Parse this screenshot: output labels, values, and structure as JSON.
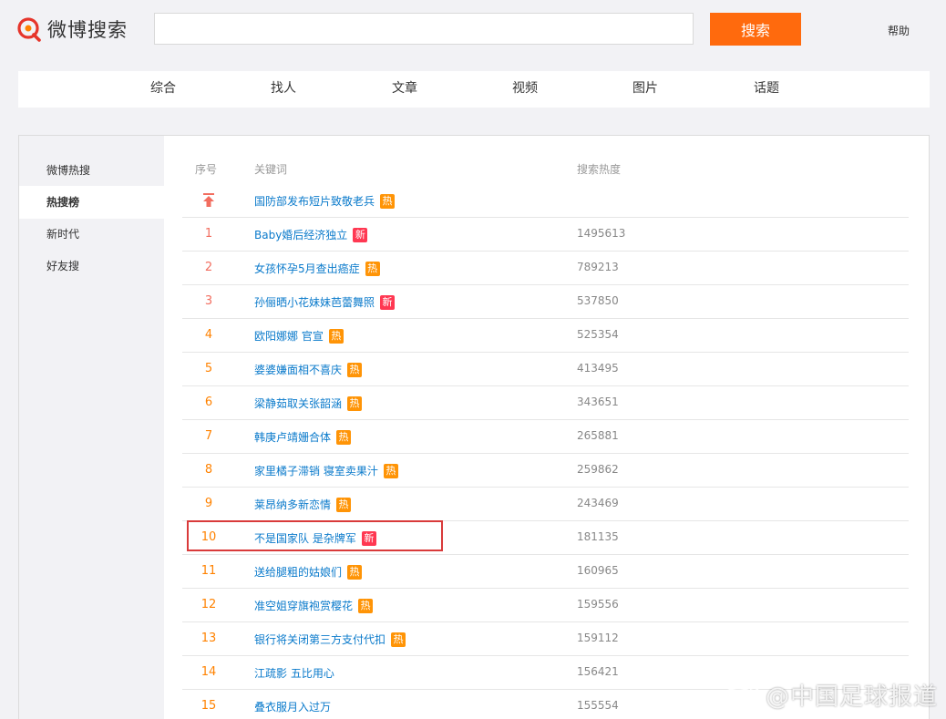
{
  "header": {
    "logo_text": "微博搜索",
    "search_placeholder": "",
    "search_button": "搜索",
    "help": "帮助"
  },
  "nav": [
    "综合",
    "找人",
    "文章",
    "视频",
    "图片",
    "话题"
  ],
  "sidebar": [
    "微博热搜",
    "热搜榜",
    "新时代",
    "好友搜"
  ],
  "table": {
    "headers": {
      "rank": "序号",
      "keyword": "关键词",
      "heat": "搜索热度"
    },
    "pinned": {
      "keyword": "国防部发布短片致敬老兵",
      "badge": "热"
    },
    "rows": [
      {
        "rank": "1",
        "keyword": "Baby婚后经济独立",
        "badge": "新",
        "heat": "1495613"
      },
      {
        "rank": "2",
        "keyword": "女孩怀孕5月查出癌症",
        "badge": "热",
        "heat": "789213"
      },
      {
        "rank": "3",
        "keyword": "孙俪晒小花妹妹芭蕾舞照",
        "badge": "新",
        "heat": "537850"
      },
      {
        "rank": "4",
        "keyword": "欧阳娜娜 官宣",
        "badge": "热",
        "heat": "525354"
      },
      {
        "rank": "5",
        "keyword": "婆婆嫌面相不喜庆",
        "badge": "热",
        "heat": "413495"
      },
      {
        "rank": "6",
        "keyword": "梁静茹取关张韶涵",
        "badge": "热",
        "heat": "343651"
      },
      {
        "rank": "7",
        "keyword": "韩庚卢靖姗合体",
        "badge": "热",
        "heat": "265881"
      },
      {
        "rank": "8",
        "keyword": "家里橘子滞销 寝室卖果汁",
        "badge": "热",
        "heat": "259862"
      },
      {
        "rank": "9",
        "keyword": "莱昂纳多新恋情",
        "badge": "热",
        "heat": "243469"
      },
      {
        "rank": "10",
        "keyword": "不是国家队 是杂牌军",
        "badge": "新",
        "heat": "181135"
      },
      {
        "rank": "11",
        "keyword": "送给腿粗的姑娘们",
        "badge": "热",
        "heat": "160965"
      },
      {
        "rank": "12",
        "keyword": "准空姐穿旗袍赏樱花",
        "badge": "热",
        "heat": "159556"
      },
      {
        "rank": "13",
        "keyword": "银行将关闭第三方支付代扣",
        "badge": "热",
        "heat": "159112"
      },
      {
        "rank": "14",
        "keyword": "江疏影 五比用心",
        "badge": "",
        "heat": "156421"
      },
      {
        "rank": "15",
        "keyword": "叠衣服月入过万",
        "badge": "",
        "heat": "155554"
      }
    ]
  },
  "watermark": "@中国足球报道",
  "colors": {
    "accent": "#ff6a0d",
    "hot_badge": "#ff9406",
    "new_badge": "#ff3852",
    "link": "#0a7acb",
    "highlight": "#d93a3a"
  }
}
